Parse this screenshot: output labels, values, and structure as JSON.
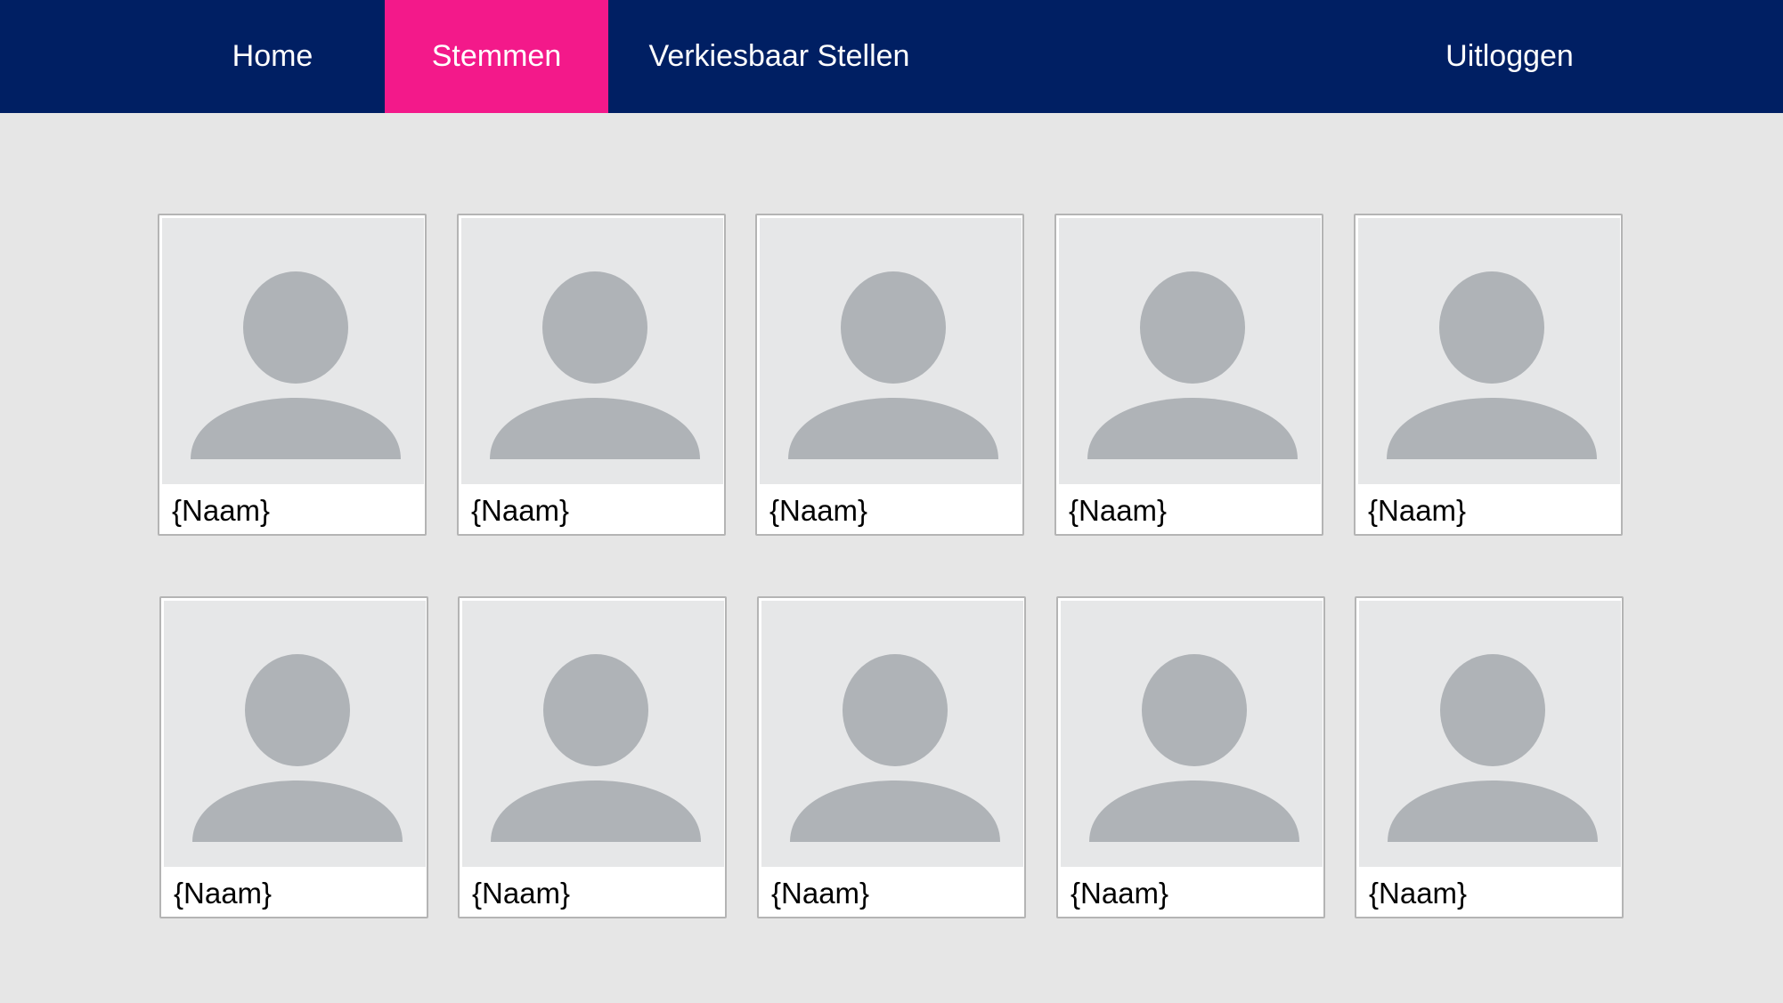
{
  "nav": {
    "home": "Home",
    "vote": "Stemmen",
    "candidate": "Verkiesbaar Stellen",
    "logout": "Uitloggen",
    "active": "Stemmen"
  },
  "colors": {
    "nav_background": "#001f63",
    "nav_active": "#f3198a",
    "page_background": "#e6e6e6",
    "avatar_placeholder": "#afb3b7"
  },
  "candidates": [
    {
      "name": "{Naam}",
      "icon": "person-placeholder-icon"
    },
    {
      "name": "{Naam}",
      "icon": "person-placeholder-icon"
    },
    {
      "name": "{Naam}",
      "icon": "person-placeholder-icon"
    },
    {
      "name": "{Naam}",
      "icon": "person-placeholder-icon"
    },
    {
      "name": "{Naam}",
      "icon": "person-placeholder-icon"
    },
    {
      "name": "{Naam}",
      "icon": "person-placeholder-icon"
    },
    {
      "name": "{Naam}",
      "icon": "person-placeholder-icon"
    },
    {
      "name": "{Naam}",
      "icon": "person-placeholder-icon"
    },
    {
      "name": "{Naam}",
      "icon": "person-placeholder-icon"
    },
    {
      "name": "{Naam}",
      "icon": "person-placeholder-icon"
    }
  ]
}
